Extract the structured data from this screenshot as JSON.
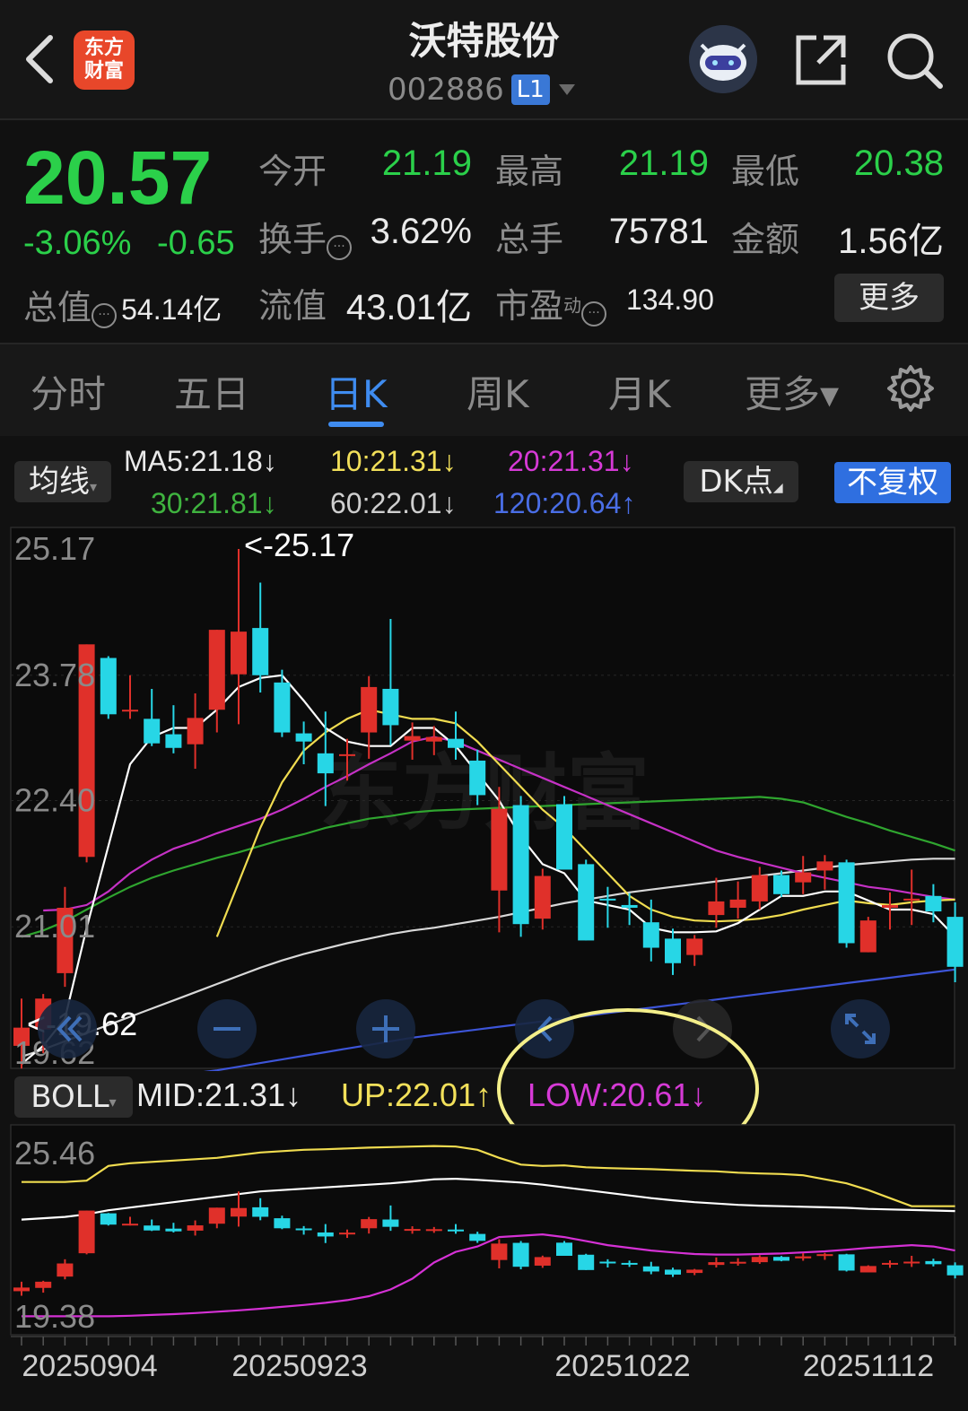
{
  "header": {
    "stock_name": "沃特股份",
    "stock_code": "002886",
    "level_badge": "L1",
    "logo_line1": "东方",
    "logo_line2": "财富",
    "icons": [
      "back-arrow-icon",
      "robot-avatar-icon",
      "share-icon",
      "search-icon",
      "chevron-down-icon"
    ]
  },
  "quote": {
    "price": "20.57",
    "change_pct": "-3.06%",
    "change_amt": "-0.65",
    "open_label": "今开",
    "open": "21.19",
    "high_label": "最高",
    "high": "21.19",
    "low_label": "最低",
    "low": "20.38",
    "turnover_label": "换手",
    "turnover": "3.62%",
    "volume_label": "总手",
    "volume": "75781",
    "amount_label": "金额",
    "amount": "1.56亿",
    "total_cap_label": "总值",
    "total_cap": "54.14亿",
    "float_cap_label": "流值",
    "float_cap": "43.01亿",
    "pe_label": "市盈",
    "pe_sup": "动",
    "pe": "134.90",
    "more_label": "更多",
    "up_color": "#e0302a",
    "down_color": "#2bd04a"
  },
  "tabs": [
    {
      "label": "分时",
      "active": false
    },
    {
      "label": "五日",
      "active": false
    },
    {
      "label": "日K",
      "active": true
    },
    {
      "label": "周K",
      "active": false
    },
    {
      "label": "月K",
      "active": false
    },
    {
      "label": "更多▾",
      "active": false
    }
  ],
  "ma_bar": {
    "selector": "均线",
    "ma5": "MA5:21.18↓",
    "ma10": "10:21.31↓",
    "ma20": "20:21.31↓",
    "ma30": "30:21.81↓",
    "ma60": "60:22.01↓",
    "ma120": "120:20.64↑",
    "dk_button": "DK点",
    "fuquan_button": "不复权"
  },
  "kline": {
    "y_ticks": [
      "25.17",
      "23.78",
      "22.40",
      "21.01",
      "19.62"
    ],
    "max_annotation": "<-25.17",
    "min_annotation": "<-19.62",
    "watermark": "东方财富",
    "controls": [
      "rewind-icon",
      "zoom-out-icon",
      "zoom-in-icon",
      "scroll-left-icon",
      "scroll-right-icon",
      "fullscreen-icon"
    ],
    "candles": [
      {
        "o": 19.7,
        "h": 20.22,
        "l": 19.45,
        "c": 19.9
      },
      {
        "o": 19.88,
        "h": 20.27,
        "l": 19.62,
        "c": 20.22
      },
      {
        "o": 20.5,
        "h": 21.45,
        "l": 20.35,
        "c": 21.22
      },
      {
        "o": 21.78,
        "h": 24.12,
        "l": 21.72,
        "c": 24.12
      },
      {
        "o": 23.97,
        "h": 23.99,
        "l": 23.3,
        "c": 23.35
      },
      {
        "o": 23.4,
        "h": 23.78,
        "l": 23.3,
        "c": 23.4
      },
      {
        "o": 23.3,
        "h": 23.63,
        "l": 23.0,
        "c": 23.03
      },
      {
        "o": 23.13,
        "h": 23.45,
        "l": 22.92,
        "c": 22.98
      },
      {
        "o": 23.02,
        "h": 23.58,
        "l": 22.75,
        "c": 23.31
      },
      {
        "o": 23.4,
        "h": 24.28,
        "l": 23.15,
        "c": 24.28
      },
      {
        "o": 23.79,
        "h": 25.17,
        "l": 23.24,
        "c": 24.26
      },
      {
        "o": 24.3,
        "h": 24.8,
        "l": 23.59,
        "c": 23.78
      },
      {
        "o": 23.7,
        "h": 23.84,
        "l": 23.1,
        "c": 23.15
      },
      {
        "o": 23.14,
        "h": 23.27,
        "l": 22.8,
        "c": 23.05
      },
      {
        "o": 22.92,
        "h": 23.38,
        "l": 22.34,
        "c": 22.7
      },
      {
        "o": 22.91,
        "h": 23.08,
        "l": 22.62,
        "c": 22.91
      },
      {
        "o": 23.15,
        "h": 23.77,
        "l": 22.86,
        "c": 23.65
      },
      {
        "o": 23.63,
        "h": 24.4,
        "l": 23.01,
        "c": 23.23
      },
      {
        "o": 23.06,
        "h": 23.26,
        "l": 22.85,
        "c": 23.11
      },
      {
        "o": 23.05,
        "h": 23.22,
        "l": 22.9,
        "c": 23.1
      },
      {
        "o": 23.08,
        "h": 23.38,
        "l": 22.85,
        "c": 22.98
      },
      {
        "o": 22.84,
        "h": 22.96,
        "l": 22.35,
        "c": 22.46
      },
      {
        "o": 21.41,
        "h": 22.55,
        "l": 20.95,
        "c": 22.31
      },
      {
        "o": 22.35,
        "h": 22.45,
        "l": 20.9,
        "c": 21.04
      },
      {
        "o": 21.1,
        "h": 21.65,
        "l": 20.98,
        "c": 21.57
      },
      {
        "o": 22.36,
        "h": 22.45,
        "l": 21.68,
        "c": 21.64
      },
      {
        "o": 21.7,
        "h": 21.75,
        "l": 20.86,
        "c": 20.86
      },
      {
        "o": 21.32,
        "h": 21.45,
        "l": 21.0,
        "c": 21.3
      },
      {
        "o": 21.25,
        "h": 21.38,
        "l": 21.03,
        "c": 21.22
      },
      {
        "o": 21.06,
        "h": 21.31,
        "l": 20.63,
        "c": 20.78
      },
      {
        "o": 20.88,
        "h": 20.99,
        "l": 20.48,
        "c": 20.61
      },
      {
        "o": 20.7,
        "h": 20.92,
        "l": 20.58,
        "c": 20.88
      },
      {
        "o": 21.14,
        "h": 21.55,
        "l": 21.0,
        "c": 21.29
      },
      {
        "o": 21.22,
        "h": 21.51,
        "l": 21.1,
        "c": 21.31
      },
      {
        "o": 21.29,
        "h": 21.67,
        "l": 21.2,
        "c": 21.58
      },
      {
        "o": 21.58,
        "h": 21.63,
        "l": 21.34,
        "c": 21.37
      },
      {
        "o": 21.5,
        "h": 21.79,
        "l": 21.37,
        "c": 21.61
      },
      {
        "o": 21.63,
        "h": 21.8,
        "l": 21.42,
        "c": 21.73
      },
      {
        "o": 21.72,
        "h": 21.75,
        "l": 20.78,
        "c": 20.83
      },
      {
        "o": 20.73,
        "h": 21.12,
        "l": 20.73,
        "c": 21.08
      },
      {
        "o": 21.22,
        "h": 21.39,
        "l": 20.98,
        "c": 21.25
      },
      {
        "o": 21.3,
        "h": 21.64,
        "l": 21.03,
        "c": 21.32
      },
      {
        "o": 21.35,
        "h": 21.48,
        "l": 21.06,
        "c": 21.18
      },
      {
        "o": 21.12,
        "h": 21.28,
        "l": 20.4,
        "c": 20.57
      }
    ],
    "ma5": [
      19.5,
      19.7,
      20.0,
      21.0,
      21.9,
      22.8,
      23.1,
      23.2,
      23.2,
      23.4,
      23.65,
      23.75,
      23.78,
      23.5,
      23.2,
      23.05,
      23.0,
      23.0,
      23.2,
      23.2,
      23.0,
      22.7,
      22.4,
      22.0,
      21.7,
      21.6,
      21.3,
      21.25,
      21.2,
      21.0,
      20.95,
      20.95,
      20.96,
      21.05,
      21.2,
      21.35,
      21.35,
      21.4,
      21.4,
      21.3,
      21.2,
      21.2,
      21.15,
      20.9
    ],
    "ma10": [
      null,
      null,
      null,
      null,
      null,
      null,
      null,
      null,
      null,
      20.9,
      21.5,
      22.1,
      22.6,
      22.95,
      23.15,
      23.3,
      23.4,
      23.35,
      23.3,
      23.3,
      23.25,
      23.05,
      22.8,
      22.55,
      22.3,
      22.1,
      21.85,
      21.6,
      21.35,
      21.2,
      21.12,
      21.08,
      21.07,
      21.08,
      21.1,
      21.14,
      21.2,
      21.25,
      21.3,
      21.27,
      21.25,
      21.28,
      21.3,
      21.31
    ],
    "ma20": [
      null,
      21.19,
      21.2,
      21.25,
      21.4,
      21.6,
      21.75,
      21.87,
      21.95,
      22.04,
      22.12,
      22.2,
      22.3,
      22.42,
      22.55,
      22.67,
      22.8,
      22.92,
      23.05,
      23.1,
      23.05,
      22.95,
      22.85,
      22.75,
      22.65,
      22.55,
      22.45,
      22.35,
      22.25,
      22.15,
      22.05,
      21.95,
      21.85,
      21.78,
      21.72,
      21.66,
      21.6,
      21.55,
      21.5,
      21.45,
      21.42,
      21.38,
      21.34,
      21.31
    ],
    "ma30": [
      20.9,
      20.97,
      21.07,
      21.2,
      21.33,
      21.45,
      21.55,
      21.63,
      21.7,
      21.77,
      21.83,
      21.9,
      21.97,
      22.03,
      22.1,
      22.15,
      22.2,
      22.23,
      22.27,
      22.29,
      22.3,
      22.31,
      22.32,
      22.33,
      22.34,
      22.35,
      22.36,
      22.37,
      22.38,
      22.39,
      22.4,
      22.41,
      22.42,
      22.43,
      22.44,
      22.42,
      22.38,
      22.3,
      22.22,
      22.15,
      22.07,
      22.0,
      21.93,
      21.85
    ],
    "ma60": [
      19.58,
      19.66,
      19.75,
      19.84,
      19.93,
      20.02,
      20.11,
      20.2,
      20.29,
      20.38,
      20.47,
      20.56,
      20.64,
      20.71,
      20.77,
      20.83,
      20.88,
      20.93,
      20.97,
      21.0,
      21.04,
      21.08,
      21.12,
      21.17,
      21.22,
      21.27,
      21.31,
      21.35,
      21.39,
      21.42,
      21.45,
      21.48,
      21.51,
      21.54,
      21.57,
      21.6,
      21.63,
      21.66,
      21.69,
      21.71,
      21.73,
      21.75,
      21.76,
      21.76
    ],
    "ma120": [
      19.2,
      19.22,
      19.24,
      19.26,
      19.28,
      19.31,
      19.34,
      19.37,
      19.4,
      19.43,
      19.47,
      19.51,
      19.55,
      19.59,
      19.63,
      19.67,
      19.71,
      19.75,
      19.79,
      19.82,
      19.85,
      19.88,
      19.91,
      19.94,
      19.97,
      20.0,
      20.03,
      20.06,
      20.09,
      20.12,
      20.15,
      20.18,
      20.21,
      20.24,
      20.27,
      20.3,
      20.33,
      20.36,
      20.39,
      20.42,
      20.45,
      20.48,
      20.51,
      20.54
    ]
  },
  "boll": {
    "selector": "BOLL",
    "mid": "MID:21.31↓",
    "up": "UP:22.01↑",
    "low": "LOW:20.61↓",
    "y_ticks": [
      "25.46",
      "19.38"
    ],
    "up_series": [
      24.4,
      24.4,
      24.4,
      24.45,
      25.0,
      25.1,
      25.15,
      25.2,
      25.25,
      25.3,
      25.4,
      25.5,
      25.55,
      25.6,
      25.62,
      25.65,
      25.68,
      25.7,
      25.72,
      25.74,
      25.72,
      25.6,
      25.3,
      25.05,
      25.0,
      25.02,
      24.95,
      24.92,
      24.9,
      24.88,
      24.85,
      24.82,
      24.8,
      24.75,
      24.72,
      24.7,
      24.65,
      24.5,
      24.35,
      24.1,
      23.8,
      23.5,
      23.5,
      23.5
    ],
    "mid_series": [
      23.0,
      23.05,
      23.1,
      23.2,
      23.35,
      23.45,
      23.55,
      23.65,
      23.75,
      23.85,
      23.95,
      24.05,
      24.1,
      24.15,
      24.2,
      24.25,
      24.3,
      24.35,
      24.42,
      24.5,
      24.52,
      24.48,
      24.43,
      24.38,
      24.3,
      24.2,
      24.1,
      24.0,
      23.9,
      23.8,
      23.72,
      23.65,
      23.6,
      23.55,
      23.52,
      23.5,
      23.48,
      23.46,
      23.44,
      23.4,
      23.38,
      23.36,
      23.34,
      23.32
    ],
    "low_series": [
      19.4,
      19.4,
      19.4,
      19.4,
      19.4,
      19.42,
      19.45,
      19.48,
      19.52,
      19.57,
      19.62,
      19.68,
      19.75,
      19.82,
      19.9,
      20.0,
      20.15,
      20.4,
      20.8,
      21.4,
      21.8,
      22.0,
      22.35,
      22.4,
      22.45,
      22.35,
      22.2,
      22.05,
      21.95,
      21.85,
      21.78,
      21.72,
      21.7,
      21.7,
      21.72,
      21.74,
      21.78,
      21.82,
      21.88,
      21.95,
      22.0,
      22.05,
      22.0,
      21.85
    ]
  },
  "x_axis": {
    "dates": [
      "20250904",
      "20250923",
      "20251022",
      "20251112"
    ]
  }
}
